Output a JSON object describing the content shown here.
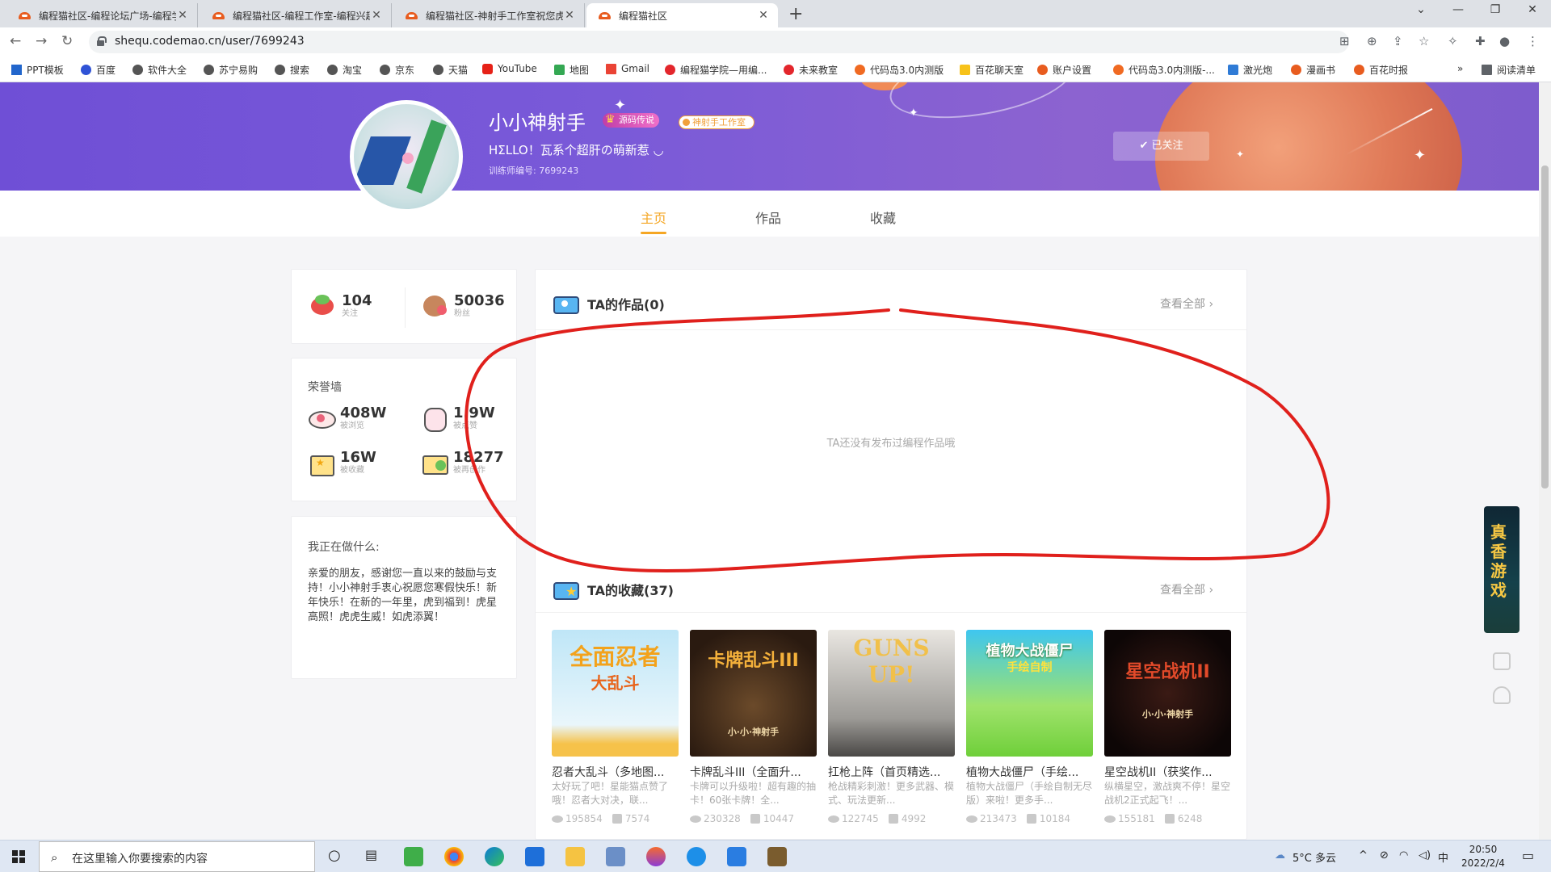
{
  "browser": {
    "tabs": [
      {
        "title": "编程猫社区-编程论坛广场-编程学..."
      },
      {
        "title": "编程猫社区-编程工作室-编程兴趣..."
      },
      {
        "title": "编程猫社区-神射手工作室祝您虎..."
      },
      {
        "title": "编程猫社区"
      }
    ],
    "new_tab": "+",
    "url": "shequ.codemao.cn/user/7699243",
    "bookmarks": [
      "PPT模板",
      "百度",
      "软件大全",
      "苏宁易购",
      "搜索",
      "淘宝",
      "京东",
      "天猫",
      "YouTube",
      "地图",
      "Gmail",
      "编程猫学院—用编...",
      "未来教室",
      "代码岛3.0内测版",
      "百花聊天室",
      "账户设置",
      "代码岛3.0内测版-...",
      "激光炮",
      "漫画书",
      "百花时报"
    ],
    "more_bookmarks": "»",
    "reading_list": "阅读清单"
  },
  "profile": {
    "username": "小小神射手",
    "badge_primary": "源码传说",
    "badge_studio": "神射手工作室",
    "motto": "HΣLLO！瓦系个超肝の萌新惹 ◡",
    "trainer_id": "训练师编号: 7699243",
    "follow_button": "已关注"
  },
  "nav_tabs": [
    {
      "label": "主页",
      "active": true
    },
    {
      "label": "作品",
      "active": false
    },
    {
      "label": "收藏",
      "active": false
    }
  ],
  "stats": {
    "following": {
      "value": "104",
      "label": "关注"
    },
    "fans": {
      "value": "50036",
      "label": "粉丝"
    }
  },
  "honor_wall": {
    "title": "荣誉墙",
    "items": [
      {
        "value": "408W",
        "label": "被浏览"
      },
      {
        "value": "1.9W",
        "label": "被点赞"
      },
      {
        "value": "16W",
        "label": "被收藏"
      },
      {
        "value": "18277",
        "label": "被再创作"
      }
    ]
  },
  "doing": {
    "title": "我正在做什么:",
    "text": "亲爱的朋友，感谢您一直以来的鼓励与支持！小小神射手衷心祝愿您寒假快乐！新年快乐！在新的一年里，虎到福到！虎星高照！虎虎生威！如虎添翼！"
  },
  "works_section": {
    "title": "TA的作品(0)",
    "see_all": "查看全部",
    "empty_text": "TA还没有发布过编程作品哦"
  },
  "favorites_section": {
    "title": "TA的收藏(37)",
    "see_all": "查看全部",
    "items": [
      {
        "thumb_text": "全面忍者",
        "thumb_sub": "大乱斗",
        "title": "忍者大乱斗（多地图...",
        "desc": "太好玩了吧！星能猫点赞了哦！忍者大对决，联...",
        "views": "195854",
        "likes": "7574"
      },
      {
        "thumb_text": "卡牌乱斗III",
        "thumb_sub": "小·小·神射手",
        "title": "卡牌乱斗III（全面升...",
        "desc": "卡牌可以升级啦！超有趣的抽卡！60张卡牌！全...",
        "views": "230328",
        "likes": "10447"
      },
      {
        "thumb_text": "GUNS UP!",
        "thumb_sub": "",
        "title": "扛枪上阵（首页精选...",
        "desc": "枪战精彩刺激！更多武器、模式、玩法更新...",
        "views": "122745",
        "likes": "4992"
      },
      {
        "thumb_text": "植物大战僵尸",
        "thumb_sub": "手绘自制",
        "title": "植物大战僵尸（手绘...",
        "desc": "植物大战僵尸（手绘自制无尽版）来啦！更多手...",
        "views": "213473",
        "likes": "10184"
      },
      {
        "thumb_text": "星空战机II",
        "thumb_sub": "小·小·神射手",
        "title": "星空战机II（获奖作...",
        "desc": "纵横星空，激战爽不停！星空战机2正式起飞！...",
        "views": "155181",
        "likes": "6248"
      }
    ]
  },
  "side_ad": {
    "text": "真香游戏"
  },
  "taskbar": {
    "search_placeholder": "在这里输入你要搜索的内容",
    "weather": "5°C 多云",
    "ime": "中",
    "time": "20:50",
    "date": "2022/2/4"
  },
  "colors": {
    "accent": "#f5a623",
    "banner": "#7a5ad8",
    "annotation": "#e0201c"
  }
}
